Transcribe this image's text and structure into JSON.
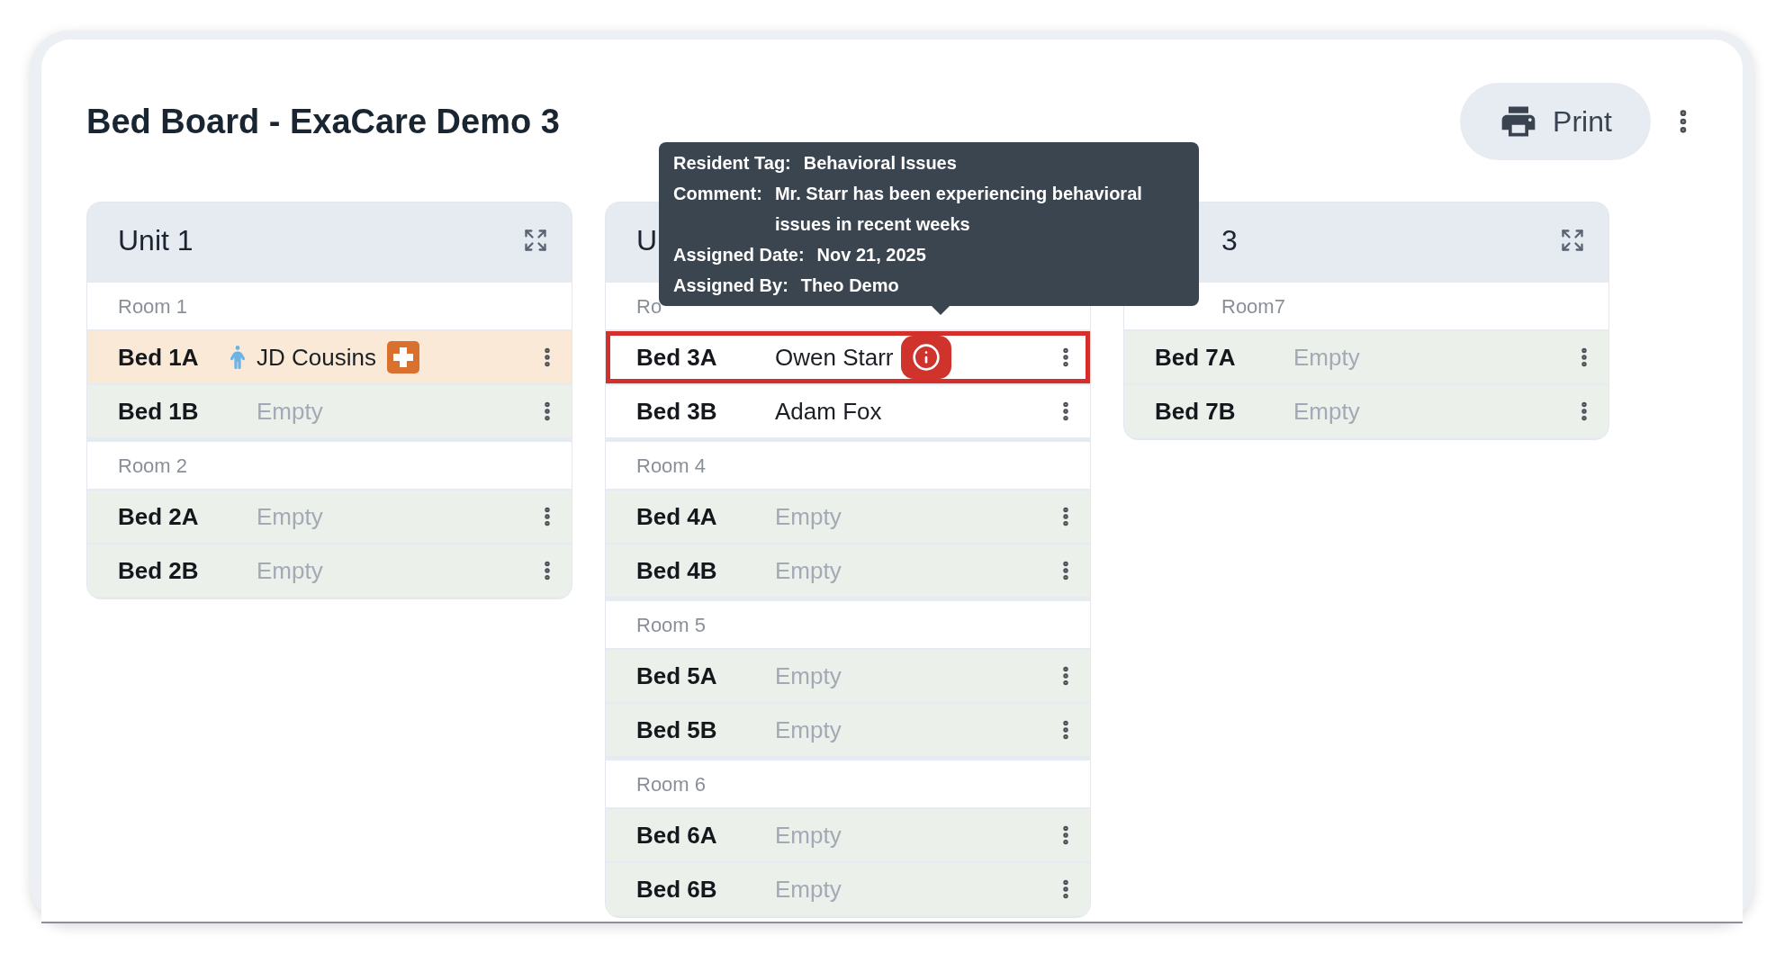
{
  "title": "Bed Board - ExaCare Demo 3",
  "print_button": {
    "label": "Print"
  },
  "units": [
    {
      "title": "Unit 1",
      "rooms": [
        {
          "label": "Room 1",
          "beds": [
            {
              "name": "Bed 1A",
              "occupant": "JD Cousins",
              "kind": "resident",
              "highlighted": true,
              "outlined": false,
              "person_icon": true,
              "badge": {
                "kind": "plus"
              }
            },
            {
              "name": "Bed 1B",
              "occupant": "Empty",
              "kind": "empty",
              "highlighted": false,
              "outlined": false
            }
          ]
        },
        {
          "label": "Room 2",
          "beds": [
            {
              "name": "Bed 2A",
              "occupant": "Empty",
              "kind": "empty",
              "highlighted": false,
              "outlined": false
            },
            {
              "name": "Bed 2B",
              "occupant": "Empty",
              "kind": "empty",
              "highlighted": false,
              "outlined": false
            }
          ]
        }
      ]
    },
    {
      "title": "U",
      "rooms": [
        {
          "label": "Ro",
          "beds": [
            {
              "name": "Bed 3A",
              "occupant": "Owen Starr",
              "kind": "resident",
              "highlighted": false,
              "outlined": true,
              "badge": {
                "kind": "info"
              }
            },
            {
              "name": "Bed 3B",
              "occupant": "Adam Fox",
              "kind": "resident",
              "highlighted": false,
              "outlined": false
            }
          ]
        },
        {
          "label": "Room 4",
          "beds": [
            {
              "name": "Bed 4A",
              "occupant": "Empty",
              "kind": "empty",
              "highlighted": false,
              "outlined": false
            },
            {
              "name": "Bed 4B",
              "occupant": "Empty",
              "kind": "empty",
              "highlighted": false,
              "outlined": false
            }
          ]
        },
        {
          "label": "Room 5",
          "beds": [
            {
              "name": "Bed 5A",
              "occupant": "Empty",
              "kind": "empty",
              "highlighted": false,
              "outlined": false
            },
            {
              "name": "Bed 5B",
              "occupant": "Empty",
              "kind": "empty",
              "highlighted": false,
              "outlined": false
            }
          ]
        },
        {
          "label": "Room 6",
          "beds": [
            {
              "name": "Bed 6A",
              "occupant": "Empty",
              "kind": "empty",
              "highlighted": false,
              "outlined": false
            },
            {
              "name": "Bed 6B",
              "occupant": "Empty",
              "kind": "empty",
              "highlighted": false,
              "outlined": false
            }
          ]
        }
      ]
    },
    {
      "title": "3",
      "rooms": [
        {
          "label": "Room7",
          "beds": [
            {
              "name": "Bed 7A",
              "occupant": "Empty",
              "kind": "empty",
              "highlighted": false,
              "outlined": false
            },
            {
              "name": "Bed 7B",
              "occupant": "Empty",
              "kind": "empty",
              "highlighted": false,
              "outlined": false
            }
          ]
        }
      ]
    }
  ],
  "tooltip": {
    "entries": [
      {
        "label": "Resident Tag:",
        "value": "Behavioral Issues"
      },
      {
        "label": "Comment:",
        "value": "Mr. Starr has been experiencing behavioral issues in recent weeks"
      },
      {
        "label": "Assigned Date:",
        "value": "Nov 21, 2025"
      },
      {
        "label": "Assigned By:",
        "value": "Theo Demo"
      }
    ]
  }
}
